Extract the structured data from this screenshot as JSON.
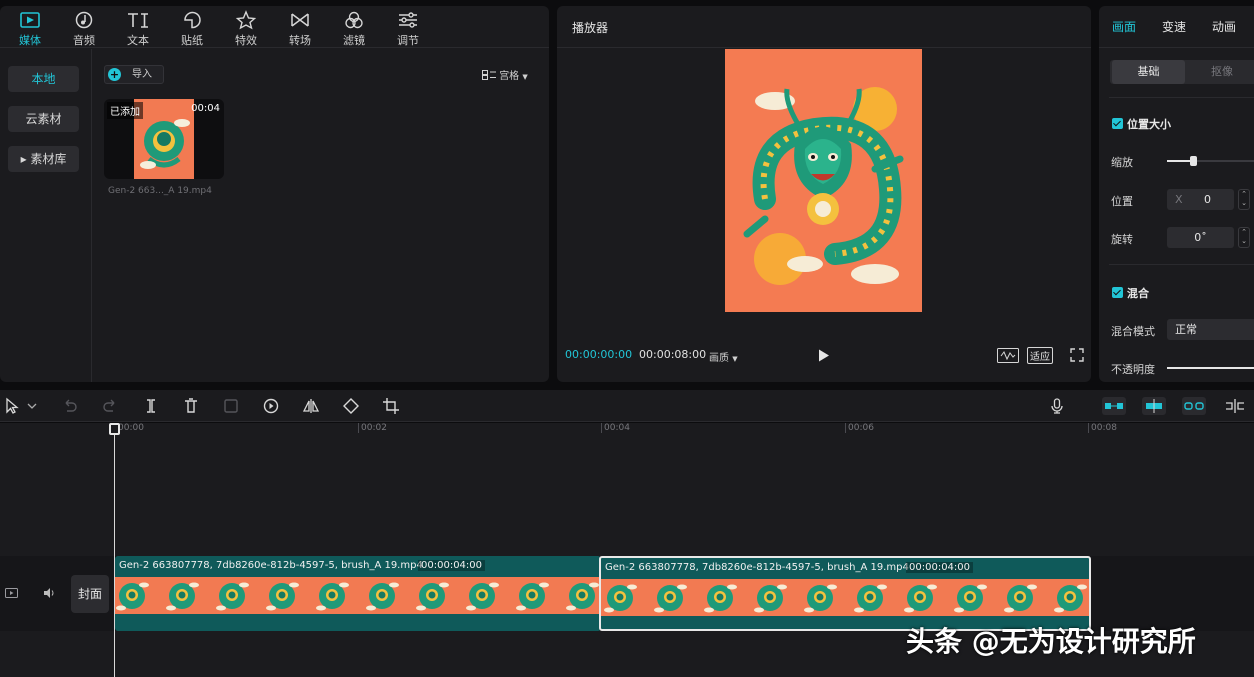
{
  "media_panel": {
    "tabs": [
      {
        "label": "媒体",
        "icon": "media-icon",
        "active": true
      },
      {
        "label": "音频",
        "icon": "audio-icon"
      },
      {
        "label": "文本",
        "icon": "text-icon"
      },
      {
        "label": "贴纸",
        "icon": "sticker-icon"
      },
      {
        "label": "特效",
        "icon": "effects-icon"
      },
      {
        "label": "转场",
        "icon": "transition-icon"
      },
      {
        "label": "滤镜",
        "icon": "filter-icon"
      },
      {
        "label": "调节",
        "icon": "adjust-icon"
      }
    ],
    "nav": [
      {
        "label": "本地",
        "active": true
      },
      {
        "label": "云素材"
      },
      {
        "label": "▸ 素材库"
      }
    ],
    "import_label": "导入",
    "view_label": "宫格",
    "asset": {
      "added_badge": "已添加",
      "duration": "00:04",
      "name": "Gen-2 663..._A 19.mp4"
    }
  },
  "player": {
    "title": "播放器",
    "current_time": "00:00:00:00",
    "total_time": "00:00:08:00",
    "quality_label": "画质",
    "fit_label": "适应",
    "accent": "#22c5d6"
  },
  "inspector": {
    "tabs": [
      {
        "label": "画面",
        "active": true
      },
      {
        "label": "变速"
      },
      {
        "label": "动画"
      }
    ],
    "subtabs": [
      {
        "label": "基础",
        "active": true
      },
      {
        "label": "抠像"
      }
    ],
    "position_size": {
      "section": "位置大小",
      "scale_label": "缩放",
      "scale_value": 0.28,
      "position_label": "位置",
      "position_x_axis": "X",
      "position_x": "0",
      "rotation_label": "旋转",
      "rotation": "0˚"
    },
    "blend": {
      "section": "混合",
      "mode_label": "混合模式",
      "mode_value": "正常",
      "opacity_label": "不透明度"
    }
  },
  "timeline": {
    "ruler": [
      "00:00",
      "00:02",
      "00:04",
      "00:06",
      "00:08"
    ],
    "cover_label": "封面",
    "clips": [
      {
        "name": "Gen-2 663807778, 7db8260e-812b-4597-5, brush_A 19.mp4",
        "duration": "00:00:04:00",
        "selected": false
      },
      {
        "name": "Gen-2 663807778, 7db8260e-812b-4597-5, brush_A 19.mp4",
        "duration": "00:00:04:00",
        "selected": true
      }
    ]
  },
  "watermark": "头条 @无为设计研究所"
}
